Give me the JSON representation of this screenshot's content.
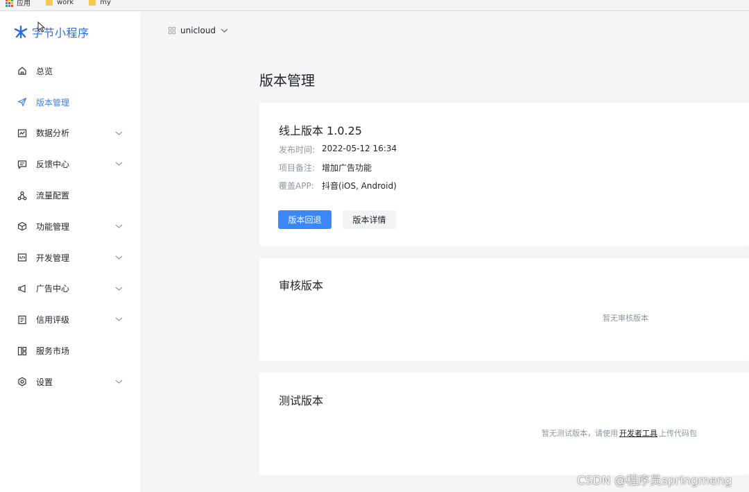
{
  "bookmarks": [
    {
      "label": "应用",
      "icon": "apps-grid-icon"
    },
    {
      "label": "work",
      "icon": "folder-icon"
    },
    {
      "label": "my",
      "icon": "folder-icon"
    }
  ],
  "brand": {
    "logo_text": "字节小程序",
    "accent": "#2b6cde"
  },
  "app_selector": {
    "label": "unicloud"
  },
  "nav": [
    {
      "label": "总览",
      "icon": "home-icon",
      "expandable": false,
      "active": false
    },
    {
      "label": "版本管理",
      "icon": "send-icon",
      "expandable": false,
      "active": true
    },
    {
      "label": "数据分析",
      "icon": "chart-icon",
      "expandable": true,
      "active": false
    },
    {
      "label": "反馈中心",
      "icon": "message-icon",
      "expandable": true,
      "active": false
    },
    {
      "label": "流量配置",
      "icon": "flow-icon",
      "expandable": false,
      "active": false
    },
    {
      "label": "功能管理",
      "icon": "cube-icon",
      "expandable": true,
      "active": false
    },
    {
      "label": "开发管理",
      "icon": "code-icon",
      "expandable": true,
      "active": false
    },
    {
      "label": "广告中心",
      "icon": "megaphone-icon",
      "expandable": true,
      "active": false
    },
    {
      "label": "信用评级",
      "icon": "credit-icon",
      "expandable": true,
      "active": false
    },
    {
      "label": "服务市场",
      "icon": "grid-icon",
      "expandable": false,
      "active": false
    },
    {
      "label": "设置",
      "icon": "settings-icon",
      "expandable": true,
      "active": false
    }
  ],
  "page": {
    "title": "版本管理"
  },
  "online": {
    "title": "线上版本 1.0.25",
    "rows": [
      {
        "key": "发布时间:",
        "value": "2022-05-12 16:34"
      },
      {
        "key": "项目备注:",
        "value": "增加广告功能"
      },
      {
        "key": "覆盖APP:",
        "value": "抖音(iOS, Android)"
      }
    ],
    "rollback_label": "版本回退",
    "detail_label": "版本详情"
  },
  "review": {
    "title": "审核版本",
    "empty_text": "暂无审核版本"
  },
  "test": {
    "title": "测试版本",
    "empty_prefix": "暂无测试版本，请使用",
    "tool_link": "开发者工具",
    "empty_suffix": "上传代码包"
  },
  "watermark": "CSDN @程序员springmeng",
  "colors": {
    "primary": "#3d86f6",
    "active_nav": "#3f7ff0",
    "muted": "#8f959e"
  }
}
